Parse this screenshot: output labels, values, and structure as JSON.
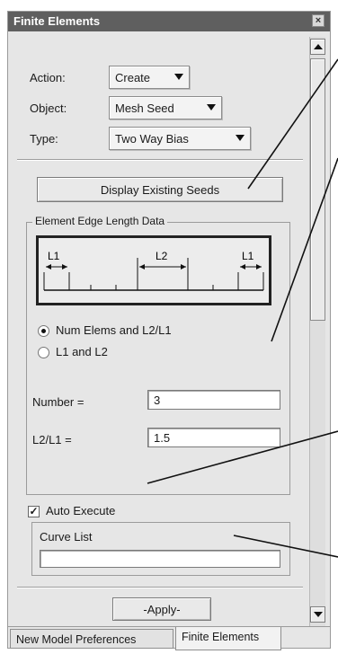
{
  "window": {
    "title": "Finite Elements",
    "close_glyph": "×"
  },
  "form": {
    "action_label": "Action:",
    "action_value": "Create",
    "object_label": "Object:",
    "object_value": "Mesh Seed",
    "type_label": "Type:",
    "type_value": "Two Way Bias",
    "display_seeds_button": "Display Existing Seeds",
    "group_title": "Element Edge Length Data",
    "diagram": {
      "left_label": "L1",
      "middle_label": "L2",
      "right_label": "L1"
    },
    "radio_options": [
      {
        "label": "Num Elems and L2/L1",
        "selected": true
      },
      {
        "label": "L1 and L2",
        "selected": false
      }
    ],
    "number_label": "Number =",
    "number_value": "3",
    "ratio_label": "L2/L1  =",
    "ratio_value": "1.5",
    "auto_execute_label": "Auto Execute",
    "auto_execute_checked": true,
    "check_glyph": "✓",
    "curve_list_label": "Curve List",
    "curve_list_value": "",
    "apply_button": "-Apply-"
  },
  "tabs": [
    {
      "label": "New Model Preferences",
      "active": false
    },
    {
      "label": "Finite Elements",
      "active": true
    }
  ],
  "icons": {
    "close": "close-icon",
    "dropdown": "chevron-down-icon",
    "scroll_up": "arrow-up-icon",
    "scroll_down": "arrow-down-icon"
  }
}
